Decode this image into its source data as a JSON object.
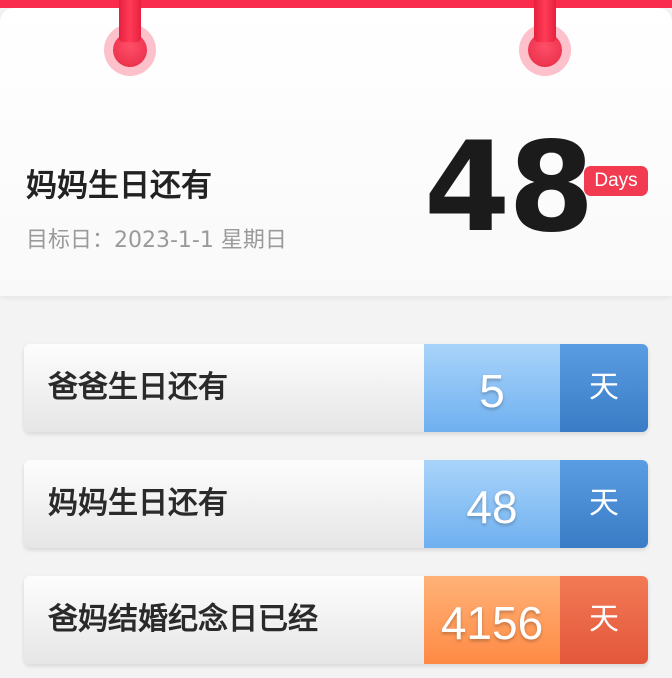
{
  "hero": {
    "title": "妈妈生日还有",
    "target_label": "目标日：2023-1-1 星期日",
    "count": "48",
    "badge": "Days"
  },
  "rows": [
    {
      "label": "爸爸生日还有",
      "value": "5",
      "unit": "天",
      "color": "blue"
    },
    {
      "label": "妈妈生日还有",
      "value": "48",
      "unit": "天",
      "color": "blue"
    },
    {
      "label": "爸妈结婚纪念日已经",
      "value": "4156",
      "unit": "天",
      "color": "orange"
    }
  ],
  "colors": {
    "accent": "#fa2c4d",
    "badge": "#f23a51",
    "blue_value": "#7ab8f2",
    "blue_unit": "#4a8dd4",
    "orange_value": "#ff9a5c",
    "orange_unit": "#ea6444"
  }
}
